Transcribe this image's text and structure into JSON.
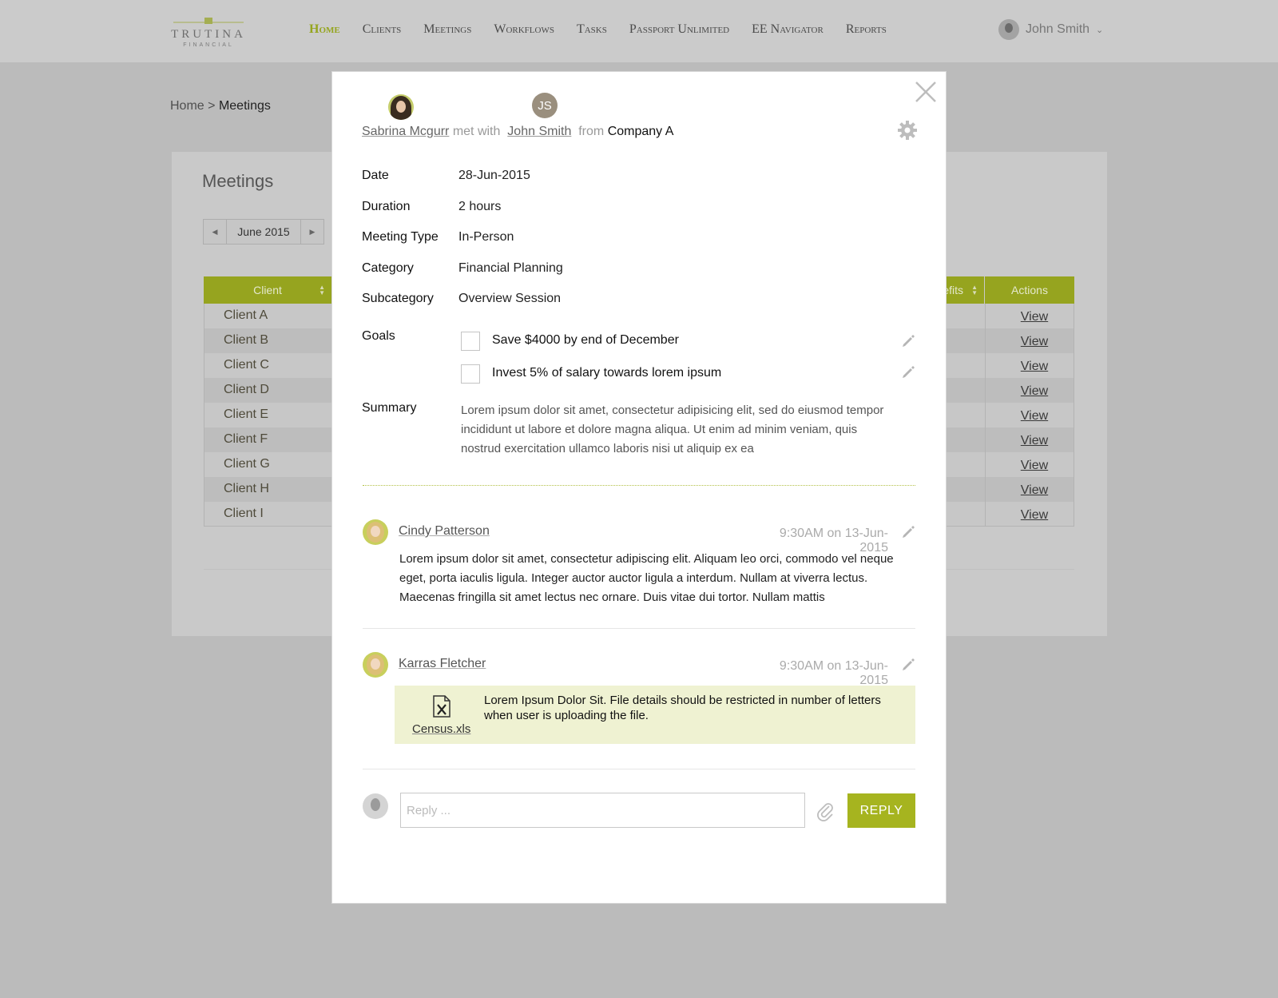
{
  "brand": {
    "name": "TRUTINA",
    "tagline": "FINANCIAL"
  },
  "nav": {
    "items": [
      "Home",
      "Clients",
      "Meetings",
      "Workflows",
      "Tasks",
      "Passport Unlimited",
      "EE Navigator",
      "Reports"
    ],
    "active": "Home"
  },
  "user": {
    "name": "John Smith"
  },
  "breadcrumb": {
    "home": "Home",
    "separator": ">",
    "current": "Meetings"
  },
  "page": {
    "title": "Meetings",
    "month": "June 2015",
    "table": {
      "columns": {
        "client": "Client",
        "benefits_partial": "efits",
        "actions": "Actions"
      },
      "rows": [
        {
          "client": "Client A",
          "action": "View"
        },
        {
          "client": "Client B",
          "action": "View"
        },
        {
          "client": "Client C",
          "action": "View"
        },
        {
          "client": "Client D",
          "action": "View"
        },
        {
          "client": "Client E",
          "action": "View"
        },
        {
          "client": "Client F",
          "action": "View"
        },
        {
          "client": "Client G",
          "action": "View"
        },
        {
          "client": "Client H",
          "action": "View"
        },
        {
          "client": "Client I",
          "action": "View"
        }
      ]
    }
  },
  "modal": {
    "header": {
      "host": "Sabrina Mcgurr",
      "met_with": "met with",
      "guest": "John Smith",
      "guest_initials": "JS",
      "from": "from",
      "company": "Company A"
    },
    "fields": {
      "date": {
        "label": "Date",
        "value": "28-Jun-2015"
      },
      "duration": {
        "label": "Duration",
        "value": "2 hours"
      },
      "meeting_type": {
        "label": "Meeting Type",
        "value": "In-Person"
      },
      "category": {
        "label": "Category",
        "value": "Financial Planning"
      },
      "subcategory": {
        "label": "Subcategory",
        "value": "Overview Session"
      }
    },
    "goals": {
      "label": "Goals",
      "items": [
        {
          "text": "Save $4000 by end of December",
          "checked": false
        },
        {
          "text": "Invest 5% of salary towards lorem ipsum",
          "checked": false
        }
      ]
    },
    "summary": {
      "label": "Summary",
      "text": "Lorem ipsum dolor sit amet, consectetur adipisicing elit, sed do eiusmod tempor incididunt ut labore et dolore magna aliqua. Ut enim ad minim veniam, quis nostrud exercitation ullamco laboris nisi ut aliquip ex ea"
    },
    "comments": [
      {
        "author": "Cindy Patterson",
        "time": "9:30AM on 13-Jun-2015",
        "text": "Lorem ipsum dolor sit amet, consectetur adipiscing elit. Aliquam leo orci, commodo vel neque eget, porta iaculis ligula. Integer auctor auctor ligula a interdum. Nullam at viverra lectus. Maecenas fringilla sit amet lectus nec ornare. Duis vitae dui tortor. Nullam mattis"
      },
      {
        "author": "Karras Fletcher",
        "time": "9:30AM on 13-Jun-2015",
        "attachment": {
          "file_name": "Census.xls",
          "description": "Lorem Ipsum Dolor Sit. File details should be restricted in number of letters when user is uploading the file."
        }
      }
    ],
    "reply": {
      "placeholder": "Reply ...",
      "button": "REPLY"
    }
  },
  "colors": {
    "accent": "#a6b41f",
    "accent_dim": "#96a41f",
    "attachment_bg": "#eff2d2",
    "overlay_bg": "#bbbbbb"
  },
  "icons": [
    "close-icon",
    "gear-icon",
    "pencil-icon",
    "excel-file-icon",
    "paperclip-icon",
    "chevron-down-icon",
    "sort-icon"
  ]
}
